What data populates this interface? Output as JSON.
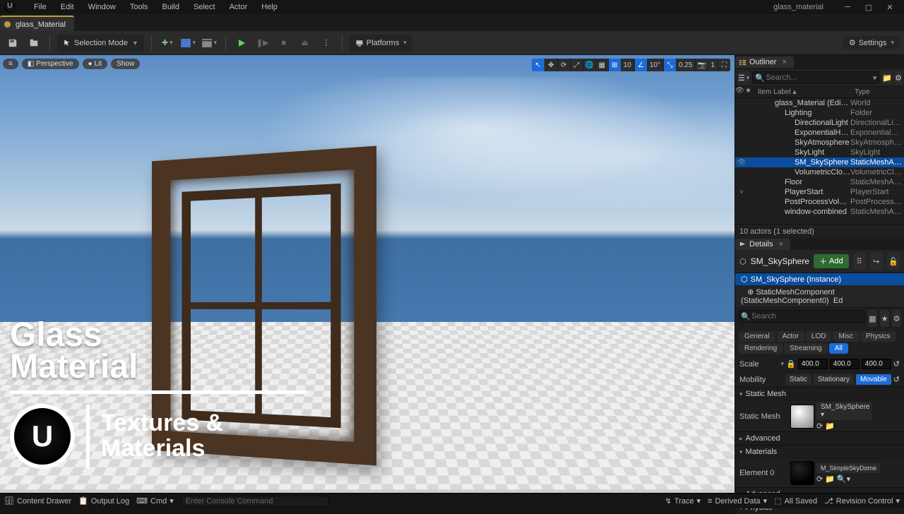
{
  "project": "glass_material",
  "menu": [
    "File",
    "Edit",
    "Window",
    "Tools",
    "Build",
    "Select",
    "Actor",
    "Help"
  ],
  "editor_tab": "glass_Material",
  "toolbar": {
    "mode": "Selection Mode",
    "platforms": "Platforms",
    "settings": "Settings"
  },
  "viewport": {
    "chips": {
      "perspective": "Perspective",
      "lit": "Lit",
      "show": "Show"
    },
    "snap": {
      "grid": "10",
      "angle": "10°",
      "scale": "0.25",
      "cam": "1"
    }
  },
  "overlay": {
    "title1": "Glass",
    "title2": "Material",
    "sub1": "Textures &",
    "sub2": "Materials"
  },
  "outliner": {
    "title": "Outliner",
    "search_ph": "Search...",
    "cols": {
      "label": "Item Label",
      "type": "Type"
    },
    "items": [
      {
        "ind": 1,
        "label": "glass_Material (Editor)",
        "type": "World",
        "icon": "globe"
      },
      {
        "ind": 2,
        "label": "Lighting",
        "type": "Folder",
        "icon": "folder"
      },
      {
        "ind": 3,
        "label": "DirectionalLight",
        "type": "DirectionalLight",
        "icon": "sun"
      },
      {
        "ind": 3,
        "label": "ExponentialHeightFog",
        "type": "ExponentialHeightFog",
        "icon": "fog"
      },
      {
        "ind": 3,
        "label": "SkyAtmosphere",
        "type": "SkyAtmosphere",
        "icon": "atmos"
      },
      {
        "ind": 3,
        "label": "SkyLight",
        "type": "SkyLight",
        "icon": "skylight"
      },
      {
        "ind": 3,
        "label": "SM_SkySphere",
        "type": "StaticMeshActor",
        "icon": "mesh",
        "sel": true,
        "vis": true
      },
      {
        "ind": 3,
        "label": "VolumetricCloud",
        "type": "VolumetricCloud",
        "icon": "cloud"
      },
      {
        "ind": 2,
        "label": "Floor",
        "type": "StaticMeshActor",
        "icon": "mesh"
      },
      {
        "ind": 2,
        "label": "PlayerStart",
        "type": "PlayerStart",
        "icon": "flag",
        "chev": true
      },
      {
        "ind": 2,
        "label": "PostProcessVolume",
        "type": "PostProcessVolume",
        "icon": "ppv"
      },
      {
        "ind": 2,
        "label": "window-combined",
        "type": "StaticMeshActor",
        "icon": "mesh"
      }
    ],
    "footer": "10 actors (1 selected)"
  },
  "details": {
    "title": "Details",
    "actor": "SM_SkySphere",
    "add": "Add",
    "instance": "SM_SkySphere (Instance)",
    "component": "StaticMeshComponent (StaticMeshComponent0)",
    "comp_suffix": "Ed",
    "search_ph": "Search",
    "filter_chips": [
      "General",
      "Actor",
      "LOD",
      "Misc",
      "Physics",
      "Rendering",
      "Streaming",
      "All"
    ],
    "scale": {
      "label": "Scale",
      "x": "400.0",
      "y": "400.0",
      "z": "400.0"
    },
    "mobility": {
      "label": "Mobility",
      "opts": [
        "Static",
        "Stationary",
        "Movable"
      ],
      "sel": "Movable"
    },
    "cat_staticmesh": "Static Mesh",
    "staticmesh_label": "Static Mesh",
    "staticmesh_val": "SM_SkySphere",
    "advanced": "Advanced",
    "cat_materials": "Materials",
    "element0_label": "Element 0",
    "element0_val": "M_SimpleSkyDome",
    "cat_physics": "Physics"
  },
  "status": {
    "content_drawer": "Content Drawer",
    "output_log": "Output Log",
    "cmd": "Cmd",
    "cmd_ph": "Enter Console Command",
    "trace": "Trace",
    "derived": "Derived Data",
    "saved": "All Saved",
    "revision": "Revision Control"
  }
}
